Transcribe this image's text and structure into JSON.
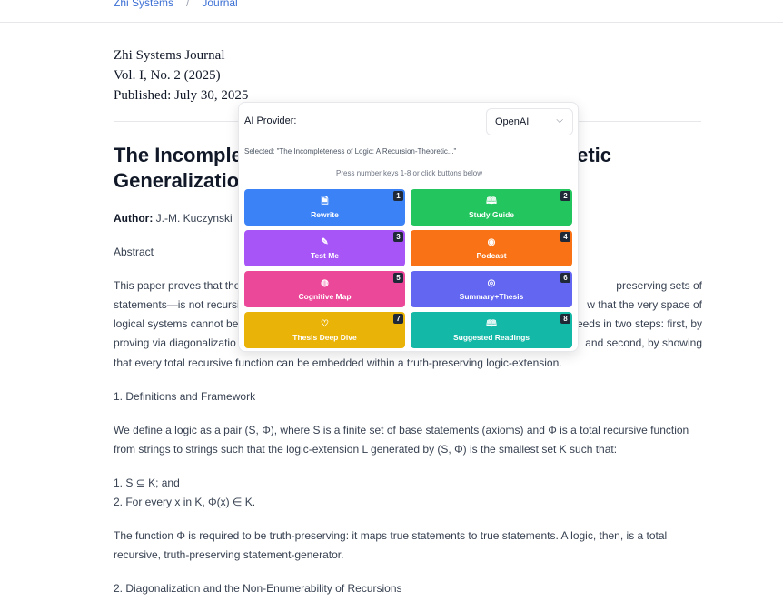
{
  "breadcrumb": {
    "home": "Zhi Systems",
    "separator": "/",
    "current": "Journal"
  },
  "meta": {
    "journal": "Zhi Systems Journal",
    "volume": "Vol. I, No. 2 (2025)",
    "published": "Published: July 30, 2025"
  },
  "article": {
    "title_line1_a": "The Incomple",
    "title_line1_b": "etic",
    "title_line2": "Generalizatio",
    "author_label": "Author:",
    "author": "J.-M. Kuczynski",
    "abstract_heading": "Abstract",
    "abstract_lines": [
      [
        "This paper proves that the",
        "preserving sets of"
      ],
      [
        "statements—is not recursi",
        "w that the very space of"
      ],
      [
        "logical systems cannot be",
        "eeds in two steps: first, by"
      ],
      [
        "proving via diagonalizatio",
        "and second, by showing"
      ]
    ],
    "abstract_last": "that every total recursive function can be embedded within a truth-preserving logic-extension.",
    "section1": "1. Definitions and Framework",
    "p1_line1": "We define a logic as a pair (S, Φ), where S is a finite set of base statements (axioms) and Φ is a total recursive function",
    "p1_line2": "from strings to strings such that the logic-extension L generated by (S, Φ) is the smallest set K such that:",
    "item1": "1. S ⊆ K; and",
    "item2": "2. For every x in K, Φ(x) ∈ K.",
    "p2_line1": "The function Φ is required to be truth-preserving: it maps true statements to true statements. A logic, then, is a total",
    "p2_line2": "recursive, truth-preserving statement-generator.",
    "section2": "2. Diagonalization and the Non-Enumerability of Recursions"
  },
  "popup": {
    "provider_label": "AI Provider:",
    "provider_value": "OpenAI",
    "selected_text": "Selected: \"The Incompleteness of Logic: A Recursion-Theoretic...\"",
    "hint": "Press number keys 1-8 or click buttons below",
    "buttons": [
      {
        "label": "Rewrite",
        "num": "1",
        "icon": "document-icon",
        "glyph": "🗎",
        "color": "#3b82f6"
      },
      {
        "label": "Study Guide",
        "num": "2",
        "icon": "book-open-icon",
        "glyph": "🕮",
        "color": "#22c55e"
      },
      {
        "label": "Test Me",
        "num": "3",
        "icon": "pencil-icon",
        "glyph": "✎",
        "color": "#a855f7"
      },
      {
        "label": "Podcast",
        "num": "4",
        "icon": "podcast-icon",
        "glyph": "◉",
        "color": "#f97316"
      },
      {
        "label": "Cognitive Map",
        "num": "5",
        "icon": "brain-icon",
        "glyph": "◍",
        "color": "#ec4899"
      },
      {
        "label": "Summary+Thesis",
        "num": "6",
        "icon": "target-icon",
        "glyph": "◎",
        "color": "#6366f1"
      },
      {
        "label": "Thesis Deep Dive",
        "num": "7",
        "icon": "lightbulb-icon",
        "glyph": "♡",
        "color": "#eab308"
      },
      {
        "label": "Suggested Readings",
        "num": "8",
        "icon": "books-icon",
        "glyph": "🕮",
        "color": "#14b8a6"
      }
    ]
  }
}
